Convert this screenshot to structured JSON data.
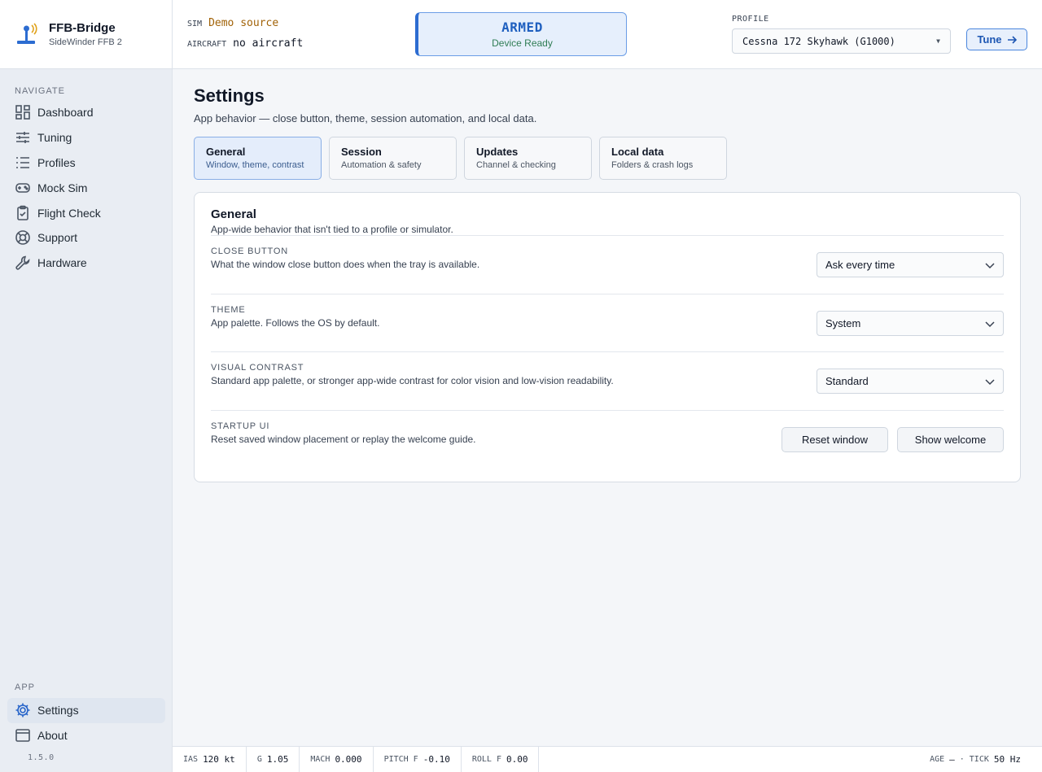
{
  "app": {
    "name": "FFB-Bridge",
    "device": "SideWinder FFB 2",
    "version": "1.5.0"
  },
  "sidebar": {
    "navigate_label": "NAVIGATE",
    "items": [
      {
        "label": "Dashboard",
        "icon": "dashboard-icon"
      },
      {
        "label": "Tuning",
        "icon": "sliders-icon"
      },
      {
        "label": "Profiles",
        "icon": "list-icon"
      },
      {
        "label": "Mock Sim",
        "icon": "gamepad-icon"
      },
      {
        "label": "Flight Check",
        "icon": "clipboard-check-icon"
      },
      {
        "label": "Support",
        "icon": "lifebuoy-icon"
      },
      {
        "label": "Hardware",
        "icon": "wrench-icon"
      }
    ],
    "app_label": "APP",
    "app_items": [
      {
        "label": "Settings",
        "icon": "gear-icon",
        "active": true
      },
      {
        "label": "About",
        "icon": "window-icon"
      }
    ]
  },
  "topbar": {
    "sim_key": "SIM",
    "sim_value": "Demo source",
    "aircraft_key": "AIRCRAFT",
    "aircraft_value": "no aircraft",
    "status_title": "ARMED",
    "status_sub": "Device Ready",
    "profile_label": "PROFILE",
    "profile_value": "Cessna 172 Skyhawk (G1000)",
    "tune_label": "Tune"
  },
  "page": {
    "title": "Settings",
    "subtitle": "App behavior — close button, theme, session automation, and local data.",
    "tabs": [
      {
        "title": "General",
        "sub": "Window, theme, contrast",
        "active": true
      },
      {
        "title": "Session",
        "sub": "Automation & safety"
      },
      {
        "title": "Updates",
        "sub": "Channel & checking"
      },
      {
        "title": "Local data",
        "sub": "Folders & crash logs"
      }
    ],
    "card": {
      "title": "General",
      "subtitle": "App-wide behavior that isn't tied to a profile or simulator.",
      "rows": [
        {
          "label": "CLOSE BUTTON",
          "desc": "What the window close button does when the tray is available.",
          "value": "Ask every time"
        },
        {
          "label": "THEME",
          "desc": "App palette. Follows the OS by default.",
          "value": "System"
        },
        {
          "label": "VISUAL CONTRAST",
          "desc": "Standard app palette, or stronger app-wide contrast for color vision and low-vision readability.",
          "value": "Standard"
        },
        {
          "label": "STARTUP UI",
          "desc": "Reset saved window placement or replay the welcome guide.",
          "btn1": "Reset window",
          "btn2": "Show welcome"
        }
      ]
    }
  },
  "statusbar": {
    "ias_k": "IAS",
    "ias_v": "120 kt",
    "g_k": "G",
    "g_v": "1.05",
    "mach_k": "MACH",
    "mach_v": "0.000",
    "pitch_k": "PITCH F",
    "pitch_v": "-0.10",
    "roll_k": "ROLL F",
    "roll_v": "0.00",
    "age_k": "AGE",
    "age_v": "—",
    "sep": "·",
    "tick_k": "TICK",
    "tick_v": "50 Hz"
  }
}
